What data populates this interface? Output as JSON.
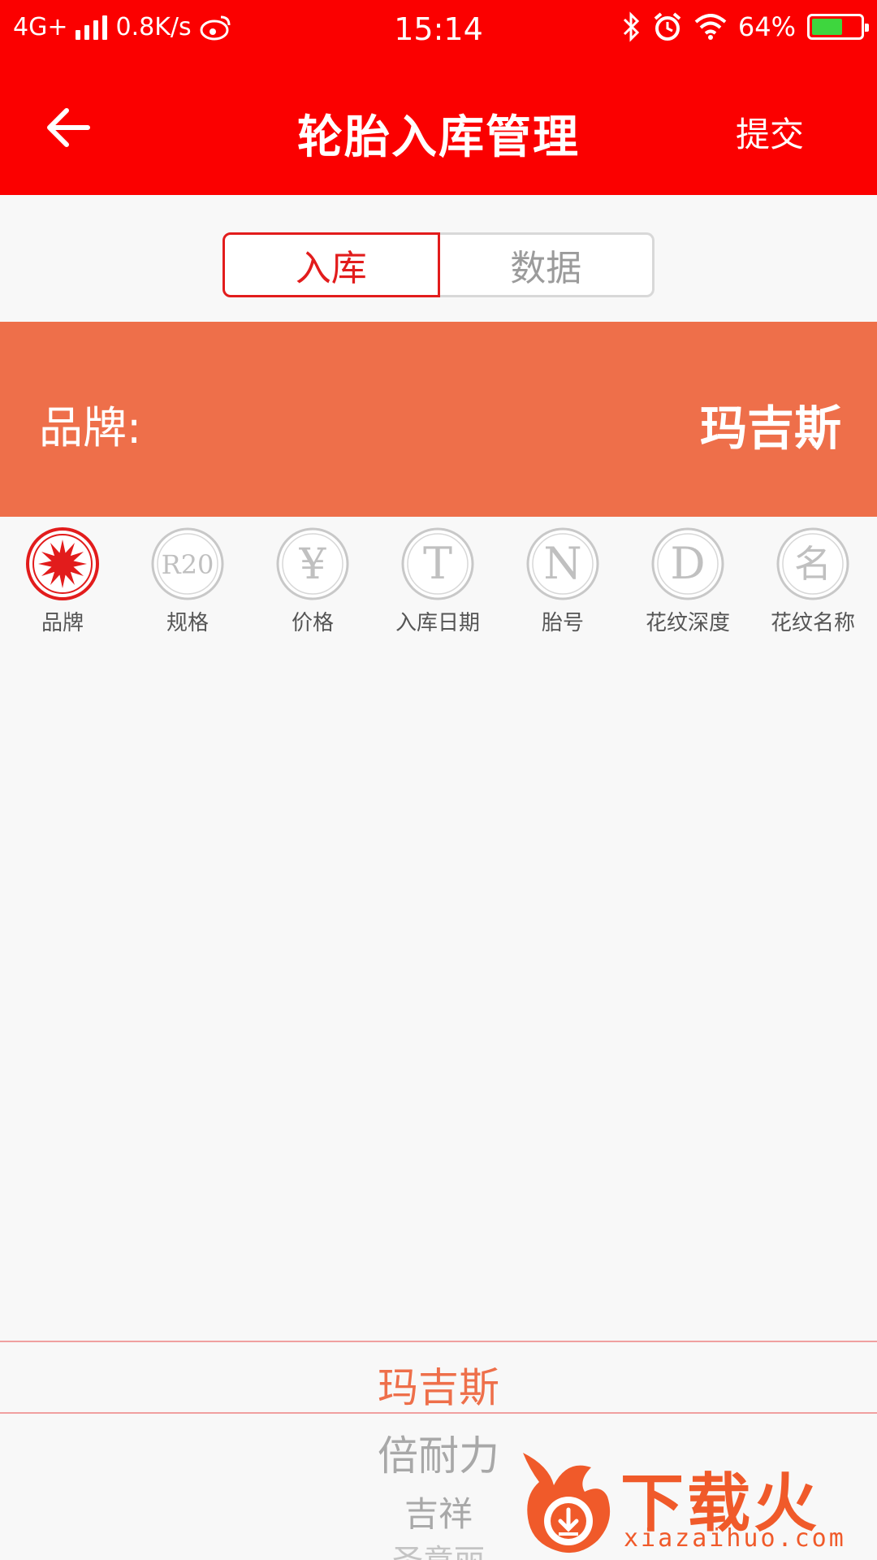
{
  "status_bar": {
    "network": "4G+",
    "speed": "0.8K/s",
    "time": "15:14",
    "battery": "64%",
    "battery_level": 0.64,
    "icons": [
      "signal-icon",
      "weibo-icon",
      "bluetooth-icon",
      "alarm-icon",
      "wifi-icon",
      "battery-icon"
    ]
  },
  "header": {
    "title": "轮胎入库管理",
    "submit_label": "提交",
    "back_icon": "arrow-left-icon"
  },
  "tabs": {
    "active": "入库",
    "inactive": "数据"
  },
  "brand_panel": {
    "label": "品牌:",
    "value": "玛吉斯"
  },
  "fields": [
    {
      "label": "品牌",
      "icon": "star-burst-icon",
      "selected": true
    },
    {
      "label": "规格",
      "icon_text": "R20",
      "selected": false
    },
    {
      "label": "价格",
      "icon_text": "¥",
      "selected": false
    },
    {
      "label": "入库日期",
      "icon_text": "T",
      "selected": false
    },
    {
      "label": "胎号",
      "icon_text": "N",
      "selected": false
    },
    {
      "label": "花纹深度",
      "icon_text": "D",
      "selected": false
    },
    {
      "label": "花纹名称",
      "icon_text": "名",
      "selected": false
    }
  ],
  "picker": {
    "selected": "玛吉斯",
    "items": [
      "倍耐力",
      "吉祥",
      "圣意丽"
    ]
  },
  "watermark": {
    "text": "下载火",
    "sub": "xiazaihuo.com"
  },
  "colors": {
    "header_red": "#fb0000",
    "panel_orange": "#ee6f4a",
    "active_red": "#e21c1c"
  }
}
